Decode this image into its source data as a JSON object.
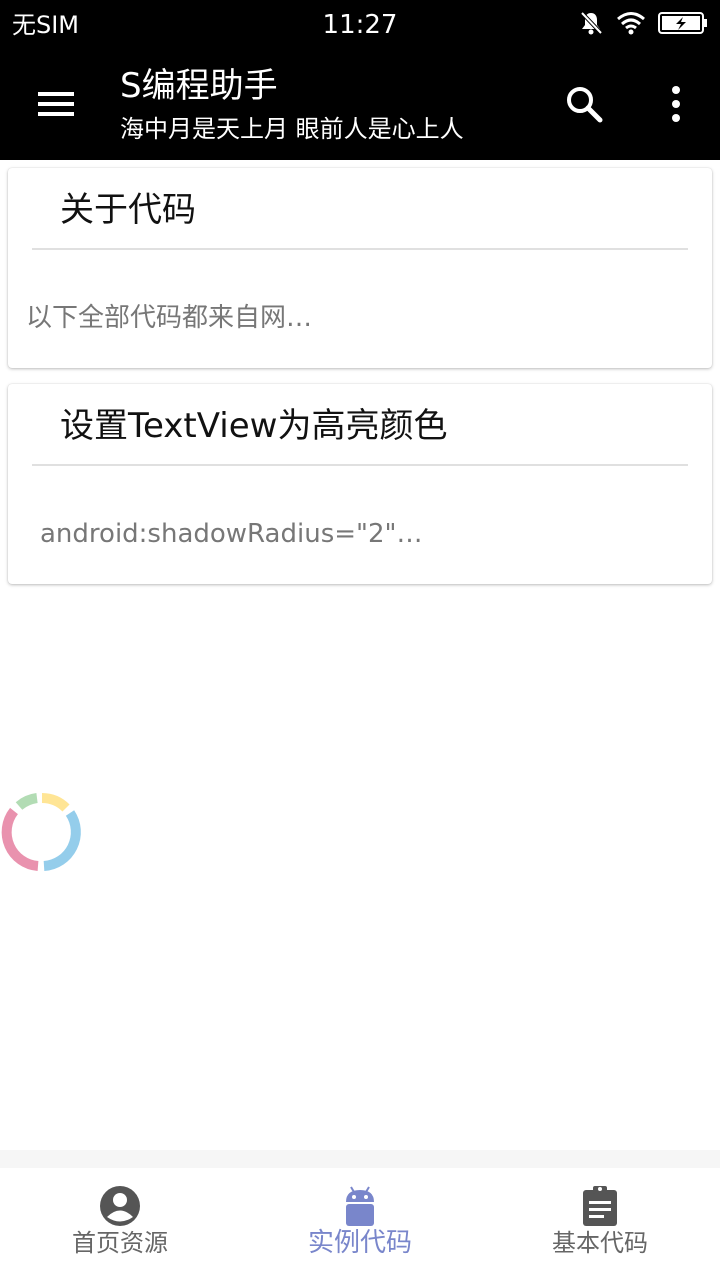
{
  "status_bar": {
    "carrier": "无SIM",
    "time": "11:27",
    "icons": [
      "mute-icon",
      "wifi-icon",
      "battery-charging-icon"
    ]
  },
  "app_bar": {
    "title": "S编程助手",
    "subtitle": "海中月是天上月 眼前人是心上人",
    "icons": [
      "menu-icon",
      "search-icon",
      "more-vert-icon"
    ]
  },
  "cards": [
    {
      "title": "关于代码",
      "text": "以下全部代码都来自网…"
    },
    {
      "title": "设置TextView为高亮颜色",
      "text": "android:shadowRadius=\"2\"…"
    }
  ],
  "bottom_nav": {
    "items": [
      {
        "label": "首页资源",
        "icon": "account-circle-icon",
        "active": false
      },
      {
        "label": "实例代码",
        "icon": "android-icon",
        "active": true
      },
      {
        "label": "基本代码",
        "icon": "clipboard-icon",
        "active": false
      }
    ]
  },
  "colors": {
    "app_bar_bg": "#000000",
    "accent": "#7986cb",
    "spinner_colors": [
      "#e57fa0",
      "#a5d6a7",
      "#ffe082",
      "#81c4e8"
    ]
  }
}
